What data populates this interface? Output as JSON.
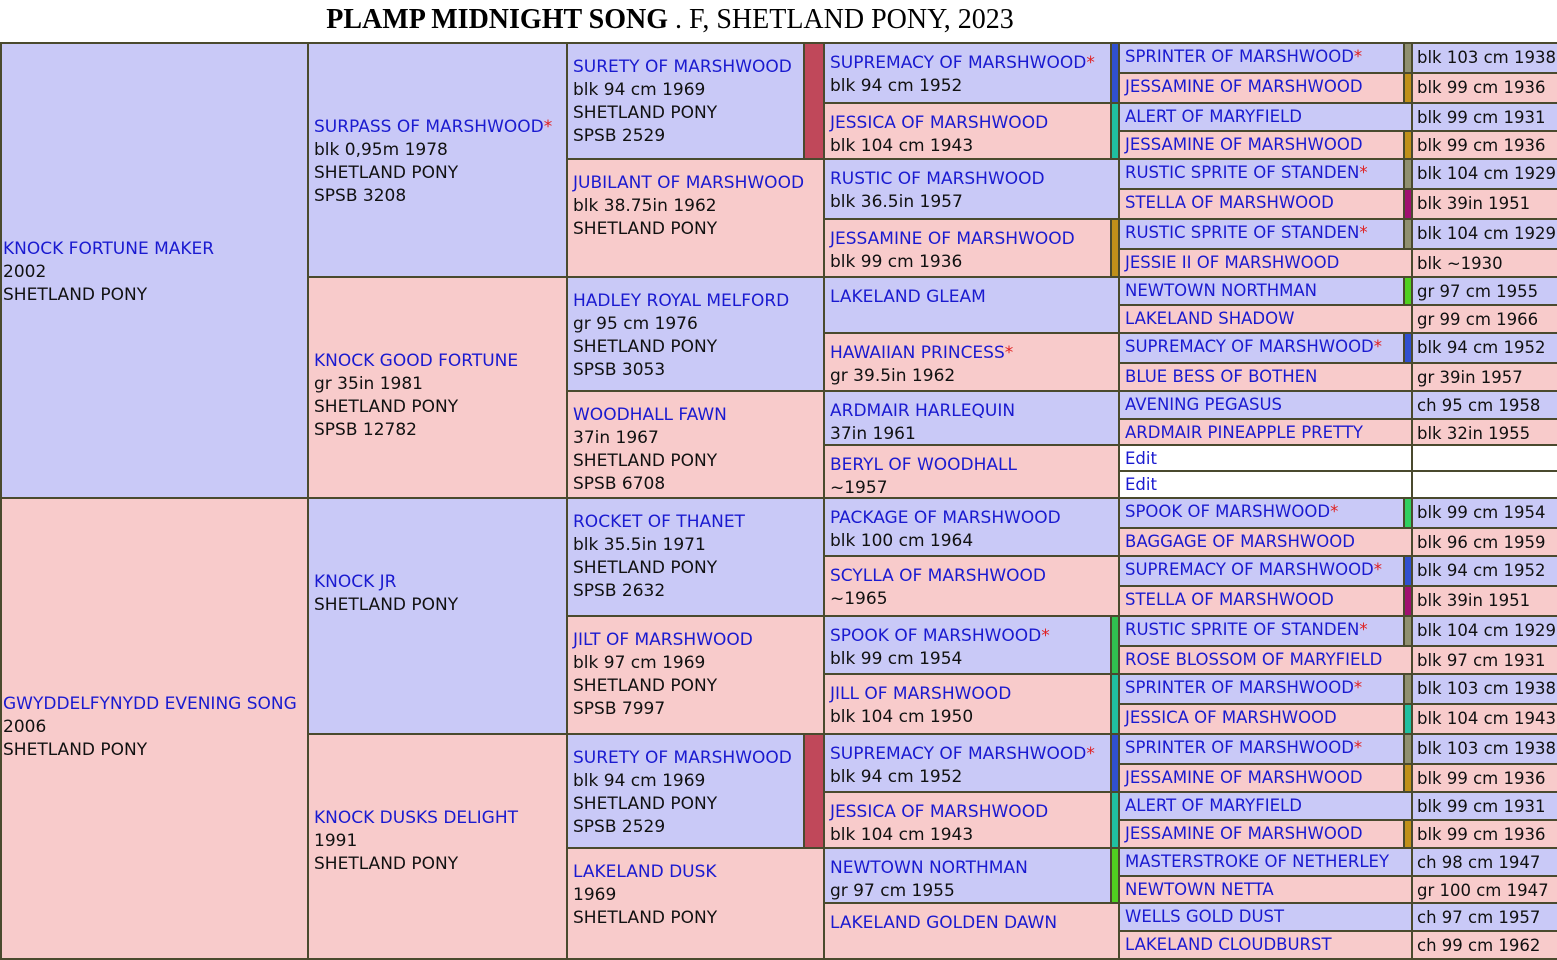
{
  "title": {
    "name": "PLAMP MIDNIGHT SONG",
    "rest": " . F, SHETLAND PONY, 2023"
  },
  "colors": {
    "male": "#c9c9f7",
    "female": "#f8cbcb",
    "border": "#4a4a2e",
    "link": "#1a1ad0",
    "star": "#e02020"
  },
  "gen1": [
    {
      "name": "KNOCK FORTUNE MAKER",
      "star": "",
      "lines": [
        "2002",
        "SHETLAND PONY"
      ]
    },
    {
      "name": "GWYDDELFYNYDD EVENING SONG",
      "star": "",
      "lines": [
        "2006",
        "SHETLAND PONY"
      ]
    }
  ],
  "gen2": [
    {
      "name": "SURPASS OF MARSHWOOD",
      "star": "*",
      "lines": [
        "blk 0,95m 1978",
        "SHETLAND PONY",
        "SPSB 3208"
      ]
    },
    {
      "name": "KNOCK GOOD FORTUNE",
      "star": "",
      "lines": [
        "gr 35in 1981",
        "SHETLAND PONY",
        "SPSB 12782"
      ]
    },
    {
      "name": "KNOCK JR",
      "star": "",
      "lines": [
        "",
        "SHETLAND PONY"
      ]
    },
    {
      "name": "KNOCK DUSKS DELIGHT",
      "star": "",
      "lines": [
        "1991",
        "SHETLAND PONY"
      ]
    }
  ],
  "gen3": [
    {
      "name": "SURETY OF MARSHWOOD",
      "star": "",
      "lines": [
        "blk 94 cm 1969",
        "SHETLAND PONY",
        "SPSB 2529"
      ]
    },
    {
      "name": "JUBILANT OF MARSHWOOD",
      "star": "",
      "lines": [
        "blk 38.75in 1962",
        "SHETLAND PONY"
      ]
    },
    {
      "name": "HADLEY ROYAL MELFORD",
      "star": "",
      "lines": [
        "gr 95 cm 1976",
        "SHETLAND PONY",
        "SPSB 3053"
      ]
    },
    {
      "name": "WOODHALL FAWN",
      "star": "",
      "lines": [
        "37in 1967",
        "SHETLAND PONY",
        "SPSB 6708"
      ]
    },
    {
      "name": "ROCKET OF THANET",
      "star": "",
      "lines": [
        "blk 35.5in 1971",
        "SHETLAND PONY",
        "SPSB 2632"
      ]
    },
    {
      "name": "JILT OF MARSHWOOD",
      "star": "",
      "lines": [
        "blk 97 cm 1969",
        "SHETLAND PONY",
        "SPSB 7997"
      ]
    },
    {
      "name": "SURETY OF MARSHWOOD",
      "star": "",
      "lines": [
        "blk 94 cm 1969",
        "SHETLAND PONY",
        "SPSB 2529"
      ]
    },
    {
      "name": "LAKELAND DUSK",
      "star": "",
      "lines": [
        "1969",
        "SHETLAND PONY"
      ]
    }
  ],
  "gen4": [
    {
      "name": "SUPREMACY OF MARSHWOOD",
      "star": "*",
      "lines": [
        "blk 94 cm 1952"
      ]
    },
    {
      "name": "JESSICA OF MARSHWOOD",
      "star": "",
      "lines": [
        "blk 104 cm 1943"
      ]
    },
    {
      "name": "RUSTIC OF MARSHWOOD",
      "star": "",
      "lines": [
        "blk 36.5in 1957"
      ]
    },
    {
      "name": "JESSAMINE OF MARSHWOOD",
      "star": "",
      "lines": [
        "blk 99 cm 1936"
      ]
    },
    {
      "name": "LAKELAND GLEAM",
      "star": "",
      "lines": []
    },
    {
      "name": "HAWAIIAN PRINCESS",
      "star": "*",
      "lines": [
        "gr 39.5in 1962"
      ]
    },
    {
      "name": "ARDMAIR HARLEQUIN",
      "star": "",
      "lines": [
        "37in 1961"
      ]
    },
    {
      "name": "BERYL OF WOODHALL",
      "star": "",
      "lines": [
        "~1957"
      ]
    },
    {
      "name": "PACKAGE OF MARSHWOOD",
      "star": "",
      "lines": [
        "blk 100 cm 1964"
      ]
    },
    {
      "name": "SCYLLA OF MARSHWOOD",
      "star": "",
      "lines": [
        "~1965"
      ]
    },
    {
      "name": "SPOOK OF MARSHWOOD",
      "star": "*",
      "lines": [
        "blk 99 cm 1954"
      ]
    },
    {
      "name": "JILL OF MARSHWOOD",
      "star": "",
      "lines": [
        "blk 104 cm 1950"
      ]
    },
    {
      "name": "SUPREMACY OF MARSHWOOD",
      "star": "*",
      "lines": [
        "blk 94 cm 1952"
      ]
    },
    {
      "name": "JESSICA OF MARSHWOOD",
      "star": "",
      "lines": [
        "blk 104 cm 1943"
      ]
    },
    {
      "name": "NEWTOWN NORTHMAN",
      "star": "",
      "lines": [
        "gr 97 cm 1955"
      ]
    },
    {
      "name": "LAKELAND GOLDEN DAWN",
      "star": "",
      "lines": []
    }
  ],
  "gen5": [
    {
      "name": "SPRINTER OF MARSHWOOD",
      "star": "*",
      "info": "blk 103 cm 1938"
    },
    {
      "name": "JESSAMINE OF MARSHWOOD",
      "star": "",
      "info": "blk 99 cm 1936"
    },
    {
      "name": "ALERT OF MARYFIELD",
      "star": "",
      "info": "blk 99 cm 1931"
    },
    {
      "name": "JESSAMINE OF MARSHWOOD",
      "star": "",
      "info": "blk 99 cm 1936"
    },
    {
      "name": "RUSTIC SPRITE OF STANDEN",
      "star": "*",
      "info": "blk 104 cm 1929"
    },
    {
      "name": "STELLA OF MARSHWOOD",
      "star": "",
      "info": "blk 39in 1951"
    },
    {
      "name": "RUSTIC SPRITE OF STANDEN",
      "star": "*",
      "info": "blk 104 cm 1929"
    },
    {
      "name": "JESSIE II OF MARSHWOOD",
      "star": "",
      "info": "blk ~1930"
    },
    {
      "name": "NEWTOWN NORTHMAN",
      "star": "",
      "info": "gr 97 cm 1955"
    },
    {
      "name": "LAKELAND SHADOW",
      "star": "",
      "info": "gr 99 cm 1966"
    },
    {
      "name": "SUPREMACY OF MARSHWOOD",
      "star": "*",
      "info": "blk 94 cm 1952"
    },
    {
      "name": "BLUE BESS OF BOTHEN",
      "star": "",
      "info": "gr 39in 1957"
    },
    {
      "name": "AVENING PEGASUS",
      "star": "",
      "info": "ch 95 cm 1958"
    },
    {
      "name": "ARDMAIR PINEAPPLE PRETTY",
      "star": "",
      "info": "blk 32in 1955"
    },
    {
      "name": "Edit",
      "star": "",
      "info": ""
    },
    {
      "name": "Edit",
      "star": "",
      "info": ""
    },
    {
      "name": "SPOOK OF MARSHWOOD",
      "star": "*",
      "info": "blk 99 cm 1954"
    },
    {
      "name": "BAGGAGE OF MARSHWOOD",
      "star": "",
      "info": "blk 96 cm 1959"
    },
    {
      "name": "SUPREMACY OF MARSHWOOD",
      "star": "*",
      "info": "blk 94 cm 1952"
    },
    {
      "name": "STELLA OF MARSHWOOD",
      "star": "",
      "info": "blk 39in 1951"
    },
    {
      "name": "RUSTIC SPRITE OF STANDEN",
      "star": "*",
      "info": "blk 104 cm 1929"
    },
    {
      "name": "ROSE BLOSSOM OF MARYFIELD",
      "star": "",
      "info": "blk 97 cm 1931"
    },
    {
      "name": "SPRINTER OF MARSHWOOD",
      "star": "*",
      "info": "blk 103 cm 1938"
    },
    {
      "name": "JESSICA OF MARSHWOOD",
      "star": "",
      "info": "blk 104 cm 1943"
    },
    {
      "name": "SPRINTER OF MARSHWOOD",
      "star": "*",
      "info": "blk 103 cm 1938"
    },
    {
      "name": "JESSAMINE OF MARSHWOOD",
      "star": "",
      "info": "blk 99 cm 1936"
    },
    {
      "name": "ALERT OF MARYFIELD",
      "star": "",
      "info": "blk 99 cm 1931"
    },
    {
      "name": "JESSAMINE OF MARSHWOOD",
      "star": "",
      "info": "blk 99 cm 1936"
    },
    {
      "name": "MASTERSTROKE OF NETHERLEY",
      "star": "",
      "info": "ch 98 cm 1947"
    },
    {
      "name": "NEWTOWN NETTA",
      "star": "",
      "info": "gr 100 cm 1947"
    },
    {
      "name": "WELLS GOLD DUST",
      "star": "",
      "info": "ch 97 cm 1957"
    },
    {
      "name": "LAKELAND CLOUDBURST",
      "star": "",
      "info": "ch 99 cm 1962"
    }
  ],
  "bars3": [
    "#c0485a",
    "",
    "",
    "",
    "",
    "",
    "#c0485a",
    ""
  ],
  "bars4": [
    "#3050d0",
    "#20c0a0",
    "",
    "#c0901a",
    "",
    "",
    "",
    "",
    "",
    "",
    "#30c050",
    "#20c0a0",
    "#3050d0",
    "#20c0a0",
    "#50d020",
    ""
  ],
  "bars5": [
    "#909070",
    "#c0901a",
    "",
    "#c0901a",
    "#909070",
    "#a01070",
    "#909070",
    "",
    "#50d020",
    "",
    "#3050d0",
    "",
    "",
    "",
    "",
    "",
    "#30d060",
    "",
    "#3050d0",
    "#a01070",
    "#909070",
    "",
    "#909070",
    "#20c0a0",
    "#909070",
    "#c0901a",
    "",
    "#c0901a",
    "",
    "",
    "",
    ""
  ]
}
